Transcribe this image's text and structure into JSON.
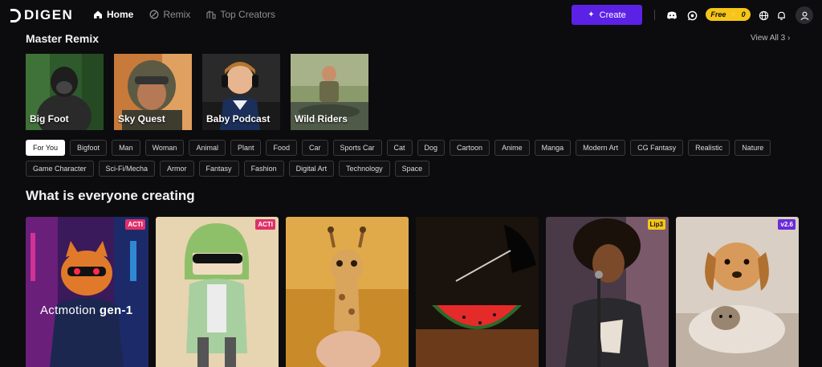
{
  "brand": {
    "name": "DIGEN"
  },
  "nav": [
    {
      "label": "Home"
    },
    {
      "label": "Remix"
    },
    {
      "label": "Top Creators"
    }
  ],
  "actions": {
    "create": "Create",
    "free": "Free",
    "credits": "0"
  },
  "master": {
    "title": "Master Remix",
    "view_all": "View All 3",
    "cards": [
      {
        "label": "Big Foot"
      },
      {
        "label": "Sky Quest"
      },
      {
        "label": "Baby Podcast"
      },
      {
        "label": "Wild Riders"
      }
    ]
  },
  "chips": [
    "For You",
    "Bigfoot",
    "Man",
    "Woman",
    "Animal",
    "Plant",
    "Food",
    "Car",
    "Sports Car",
    "Cat",
    "Dog",
    "Cartoon",
    "Anime",
    "Manga",
    "Modern Art",
    "CG Fantasy",
    "Realistic",
    "Nature",
    "Game Character",
    "Sci-Fi/Mecha",
    "Armor",
    "Fantasy",
    "Fashion",
    "Digital Art",
    "Technology",
    "Space"
  ],
  "feed": {
    "title": "What is everyone creating",
    "cards": [
      {
        "badge": "ACTI",
        "badge_color": "#e0306a",
        "overlay": "Actmotion",
        "overlay_bold": "gen-1"
      },
      {
        "badge": "ACTI",
        "badge_color": "#e0306a"
      },
      {
        "badge": ""
      },
      {
        "badge": ""
      },
      {
        "badge": "Lip3",
        "badge_color": "#f5c518"
      },
      {
        "badge": "v2.6",
        "badge_color": "#6a2bd9"
      }
    ]
  }
}
